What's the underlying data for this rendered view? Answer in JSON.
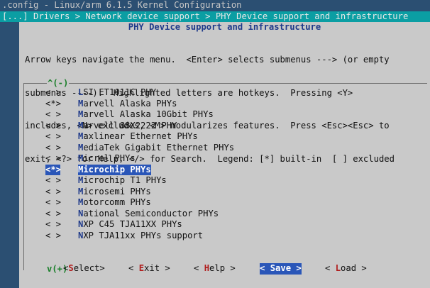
{
  "terminal": {
    "title_line": ".config - Linux/arm 6.1.5 Kernel Configuration",
    "breadcrumb": "[...] Drivers > Network device support > PHY Device support and infrastructure"
  },
  "dialog": {
    "title": "PHY Device support and infrastructure",
    "help_lines": [
      "Arrow keys navigate the menu.  <Enter> selects submenus ---> (or empty",
      "submenus ----).  Highlighted letters are hotkeys.  Pressing <Y>",
      "includes, <N> excludes, <M> modularizes features.  Press <Esc><Esc> to",
      "exit, <?> for Help, </> for Search.  Legend: [*] built-in  [ ] excluded"
    ],
    "scroll_up": "^(-)",
    "scroll_down": "v(+)"
  },
  "menu": {
    "items": [
      {
        "state": "< >",
        "hotkey": "L",
        "rest": "SI ET1011C PHY"
      },
      {
        "state": "<*>",
        "hotkey": "M",
        "rest": "arvell Alaska PHYs"
      },
      {
        "state": "< >",
        "hotkey": "M",
        "rest": "arvell Alaska 10Gbit PHYs"
      },
      {
        "state": "< >",
        "hotkey": "M",
        "rest": "arvell 88X2222 PHY"
      },
      {
        "state": "< >",
        "hotkey": "M",
        "rest": "axlinear Ethernet PHYs"
      },
      {
        "state": "< >",
        "hotkey": "M",
        "rest": "ediaTek Gigabit Ethernet PHYs"
      },
      {
        "state": "< >",
        "hotkey": "M",
        "rest": "icrel PHYs"
      },
      {
        "state": "<*>",
        "hotkey": "M",
        "rest": "icrochip PHYs",
        "selected": true
      },
      {
        "state": "< >",
        "hotkey": "M",
        "rest": "icrochip T1 PHYs"
      },
      {
        "state": "< >",
        "hotkey": "M",
        "rest": "icrosemi PHYs"
      },
      {
        "state": "< >",
        "hotkey": "M",
        "rest": "otorcomm PHYs"
      },
      {
        "state": "< >",
        "hotkey": "N",
        "rest": "ational Semiconductor PHYs"
      },
      {
        "state": "< >",
        "hotkey": "N",
        "rest": "XP C45 TJA11XX PHYs"
      },
      {
        "state": "< >",
        "hotkey": "N",
        "rest": "XP TJA11xx PHYs support"
      }
    ]
  },
  "buttons": {
    "select": {
      "open": "<",
      "hotkey": "S",
      "rest": "elect",
      "close": ">"
    },
    "exit": {
      "open": "< ",
      "hotkey": "E",
      "rest": "xit",
      "close": " >"
    },
    "help": {
      "open": "< ",
      "hotkey": "H",
      "rest": "elp",
      "close": " >"
    },
    "save": {
      "open": "< ",
      "hotkey": "S",
      "rest": "ave",
      "close": " >"
    },
    "load": {
      "open": "< ",
      "hotkey": "L",
      "rest": "oad",
      "close": " >"
    }
  },
  "colors": {
    "background": "#2b4f72",
    "header_bar": "#0b9ea3",
    "dialog": "#c9c9c9",
    "selection": "#2a56b8",
    "hotkey_menu": "#1f3a8a",
    "hotkey_button": "#b01c1c",
    "scroll_indicator": "#1a7f2a"
  }
}
